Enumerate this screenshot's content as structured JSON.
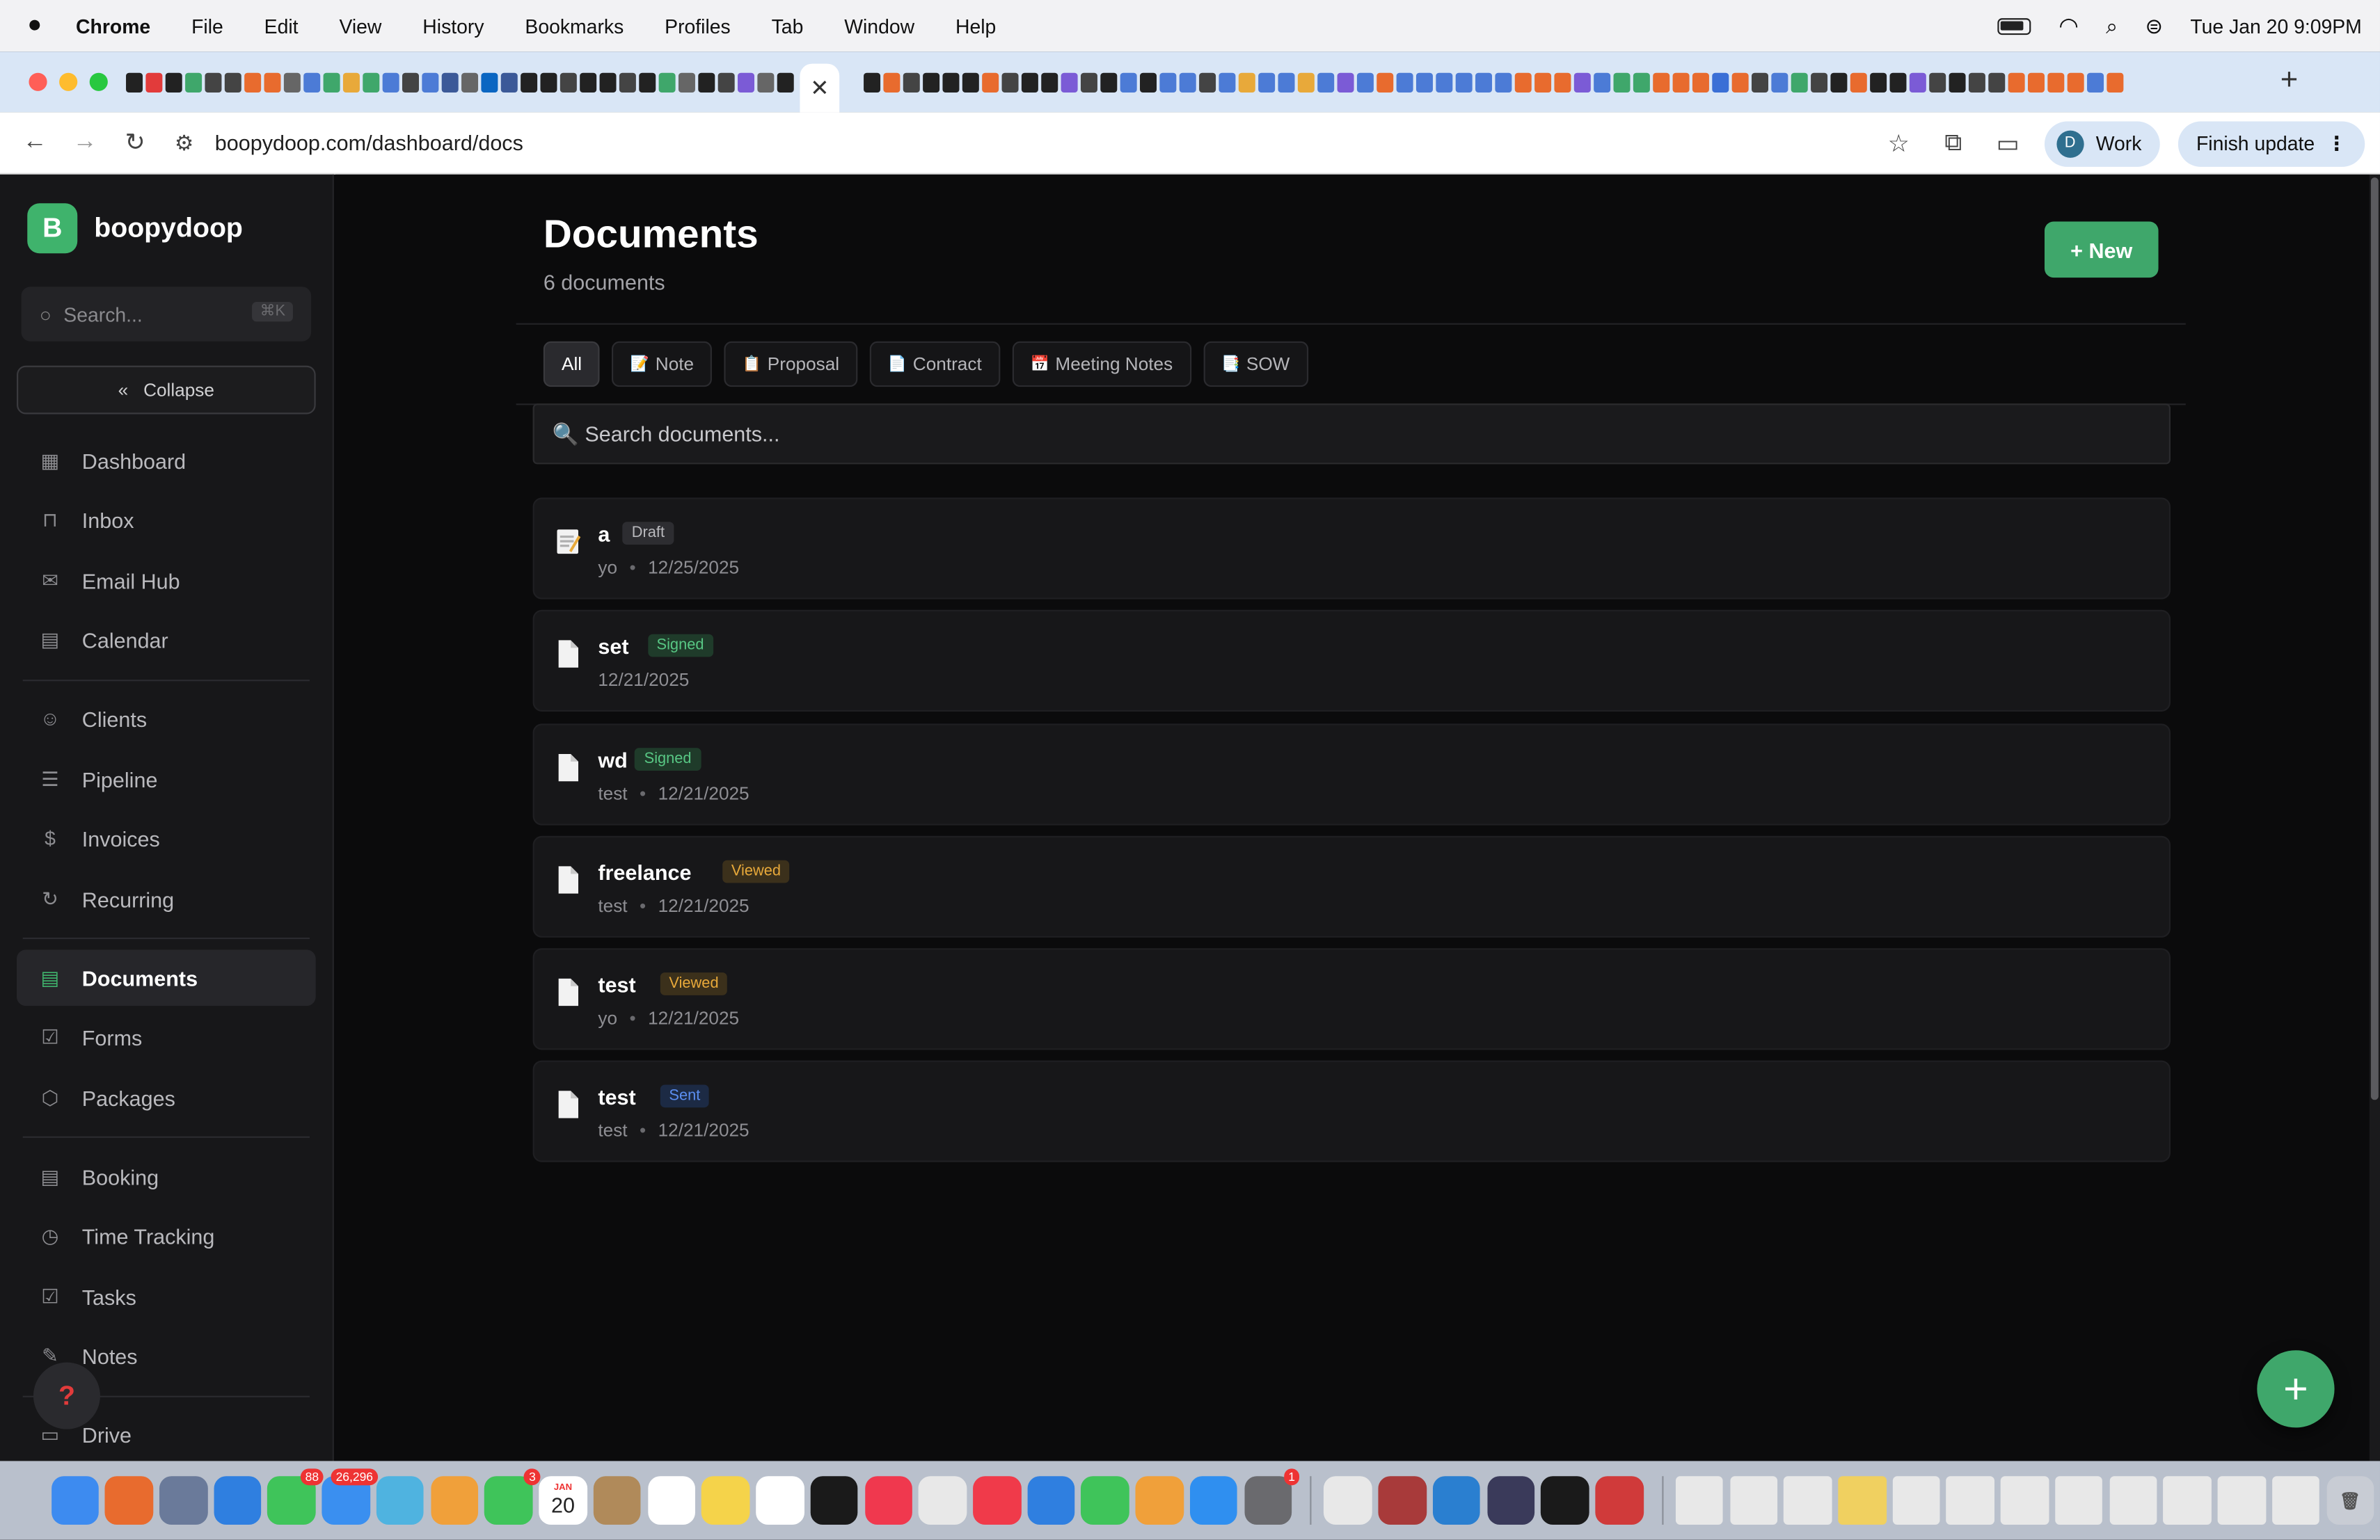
{
  "menubar": {
    "app": "Chrome",
    "items": [
      "File",
      "Edit",
      "View",
      "History",
      "Bookmarks",
      "Profiles",
      "Tab",
      "Window",
      "Help"
    ],
    "clock": "Tue Jan 20  9:09PM"
  },
  "browser": {
    "close_tab_glyph": "✕",
    "new_tab_glyph": "+",
    "url": "boopydoop.com/dashboard/docs",
    "profile_initial": "D",
    "profile_label": "Work",
    "update_label": "Finish update",
    "favicon_colors": [
      "#222",
      "#e23b3b",
      "#222",
      "#3fa76b",
      "#444",
      "#444",
      "#e86b2e",
      "#e86b2e",
      "#666",
      "#4c7bd6",
      "#3fa76b",
      "#e8a93a",
      "#3fa76b",
      "#4c7bd6",
      "#444",
      "#4c7bd6",
      "#3b5998",
      "#666",
      "#0a66c2",
      "#3b5998",
      "#222",
      "#222",
      "#444",
      "#222",
      "#222",
      "#444",
      "#222",
      "#3fa76b",
      "#666",
      "#222",
      "#444",
      "#7b5bd6",
      "#666",
      "#222"
    ],
    "favicon_colors_right": [
      "#222",
      "#e86b2e",
      "#444",
      "#222",
      "#222",
      "#222",
      "#e86b2e",
      "#444",
      "#222",
      "#222",
      "#7b5bd6",
      "#444",
      "#222",
      "#4c7bd6",
      "#222",
      "#4c7bd6",
      "#4c7bd6",
      "#444",
      "#4c7bd6",
      "#e8a93a",
      "#4c7bd6",
      "#4c7bd6",
      "#e8a93a",
      "#4c7bd6",
      "#7b5bd6",
      "#4c7bd6",
      "#e86b2e",
      "#4c7bd6",
      "#4c7bd6",
      "#4c7bd6",
      "#4c7bd6",
      "#4c7bd6",
      "#4c7bd6",
      "#e86b2e",
      "#e86b2e",
      "#e86b2e",
      "#7b5bd6",
      "#4c7bd6",
      "#3fa76b",
      "#3fa76b",
      "#e86b2e",
      "#e86b2e",
      "#e86b2e",
      "#3a6fd6",
      "#e86b2e",
      "#444",
      "#4c7bd6",
      "#3fa76b",
      "#444",
      "#222",
      "#e86b2e",
      "#222",
      "#222",
      "#7b5bd6",
      "#444",
      "#222",
      "#444",
      "#444",
      "#e86b2e",
      "#e86b2e",
      "#e86b2e",
      "#e86b2e",
      "#4c7bd6",
      "#e86b2e"
    ]
  },
  "sidebar": {
    "brand_initial": "B",
    "brand_name": "boopydoop",
    "search_placeholder": "Search...",
    "search_kbd": "⌘K",
    "collapse_label": "Collapse",
    "groups": [
      [
        {
          "label": "Dashboard",
          "icon": "grid-icon",
          "glyph": "▦",
          "active": false
        },
        {
          "label": "Inbox",
          "icon": "inbox-icon",
          "glyph": "⊓",
          "active": false
        },
        {
          "label": "Email Hub",
          "icon": "mail-icon",
          "glyph": "✉",
          "active": false
        },
        {
          "label": "Calendar",
          "icon": "calendar-icon",
          "glyph": "▤",
          "active": false
        }
      ],
      [
        {
          "label": "Clients",
          "icon": "users-icon",
          "glyph": "☺",
          "active": false
        },
        {
          "label": "Pipeline",
          "icon": "list-icon",
          "glyph": "☰",
          "active": false
        },
        {
          "label": "Invoices",
          "icon": "dollar-icon",
          "glyph": "$",
          "active": false
        },
        {
          "label": "Recurring",
          "icon": "refresh-icon",
          "glyph": "↻",
          "active": false
        }
      ],
      [
        {
          "label": "Documents",
          "icon": "document-icon",
          "glyph": "▤",
          "active": true
        },
        {
          "label": "Forms",
          "icon": "checkbox-icon",
          "glyph": "☑",
          "active": false
        },
        {
          "label": "Packages",
          "icon": "package-icon",
          "glyph": "⬡",
          "active": false
        }
      ],
      [
        {
          "label": "Booking",
          "icon": "calendar-icon",
          "glyph": "▤",
          "active": false
        },
        {
          "label": "Time Tracking",
          "icon": "clock-icon",
          "glyph": "◷",
          "active": false
        },
        {
          "label": "Tasks",
          "icon": "checkbox-icon",
          "glyph": "☑",
          "active": false
        },
        {
          "label": "Notes",
          "icon": "pencil-icon",
          "glyph": "✎",
          "active": false
        }
      ],
      [
        {
          "label": "Drive",
          "icon": "folder-icon",
          "glyph": "▭",
          "active": false
        }
      ]
    ]
  },
  "main": {
    "title": "Documents",
    "subtitle": "6 documents",
    "new_label": "+ New",
    "filters": [
      {
        "label": "All",
        "icon": "",
        "active": true
      },
      {
        "label": "Note",
        "icon": "📝",
        "active": false
      },
      {
        "label": "Proposal",
        "icon": "📋",
        "active": false
      },
      {
        "label": "Contract",
        "icon": "📄",
        "active": false
      },
      {
        "label": "Meeting Notes",
        "icon": "📅",
        "active": false
      },
      {
        "label": "SOW",
        "icon": "📑",
        "active": false
      }
    ],
    "search_placeholder": "🔍 Search documents...",
    "docs": [
      {
        "title": "a",
        "status": "Draft",
        "status_type": "draft",
        "client": "yo",
        "date": "12/25/2025",
        "icon": "note"
      },
      {
        "title": "set",
        "status": "Signed",
        "status_type": "signed",
        "client": "",
        "date": "12/21/2025",
        "icon": "page"
      },
      {
        "title": "wd",
        "status": "Signed",
        "status_type": "signed",
        "client": "test",
        "date": "12/21/2025",
        "icon": "page"
      },
      {
        "title": "freelance",
        "status": "Viewed",
        "status_type": "viewed",
        "client": "test",
        "date": "12/21/2025",
        "icon": "page"
      },
      {
        "title": "test",
        "status": "Viewed",
        "status_type": "viewed",
        "client": "yo",
        "date": "12/21/2025",
        "icon": "page"
      },
      {
        "title": "test",
        "status": "Sent",
        "status_type": "sent",
        "client": "test",
        "date": "12/21/2025",
        "icon": "page"
      }
    ],
    "fab_label": "+"
  },
  "dock": {
    "apps": [
      {
        "name": "finder",
        "color": "#3d8bf0",
        "badge": ""
      },
      {
        "name": "launchpad",
        "color": "#e86b2e",
        "badge": ""
      },
      {
        "name": "preview",
        "color": "#6a7a9a",
        "badge": ""
      },
      {
        "name": "safari",
        "color": "#2f7fe0",
        "badge": ""
      },
      {
        "name": "messages",
        "color": "#3fc45a",
        "badge": "88"
      },
      {
        "name": "mail",
        "color": "#3a8ff0",
        "badge": "26,296"
      },
      {
        "name": "maps",
        "color": "#4fb3e0",
        "badge": ""
      },
      {
        "name": "photos",
        "color": "#f0a03a",
        "badge": ""
      },
      {
        "name": "facetime",
        "color": "#3fc45a",
        "badge": "3"
      },
      {
        "name": "calendar",
        "color": "#ffffff",
        "badge": ""
      },
      {
        "name": "contacts",
        "color": "#b08a5a",
        "badge": ""
      },
      {
        "name": "reminders",
        "color": "#ffffff",
        "badge": ""
      },
      {
        "name": "notes",
        "color": "#f5d34a",
        "badge": ""
      },
      {
        "name": "freeform",
        "color": "#ffffff",
        "badge": ""
      },
      {
        "name": "tv",
        "color": "#1a1a1a",
        "badge": ""
      },
      {
        "name": "music",
        "color": "#f0384e",
        "badge": ""
      },
      {
        "name": "chrome",
        "color": "#e8e8e8",
        "badge": ""
      },
      {
        "name": "news",
        "color": "#f03a4a",
        "badge": ""
      },
      {
        "name": "keynote",
        "color": "#2f7fe0",
        "badge": ""
      },
      {
        "name": "numbers",
        "color": "#3fc45a",
        "badge": ""
      },
      {
        "name": "pages",
        "color": "#f0a03a",
        "badge": ""
      },
      {
        "name": "app-store",
        "color": "#2f8ff0",
        "badge": ""
      },
      {
        "name": "system-settings",
        "color": "#6a6a6e",
        "badge": "1"
      },
      {
        "name": "textedit",
        "color": "#e8e8e8",
        "badge": ""
      },
      {
        "name": "dictionary",
        "color": "#a83a3a",
        "badge": ""
      },
      {
        "name": "vscode",
        "color": "#2a7fd0",
        "badge": ""
      },
      {
        "name": "stack",
        "color": "#3a3a5a",
        "badge": ""
      },
      {
        "name": "terminal",
        "color": "#1a1a1a",
        "badge": ""
      },
      {
        "name": "photo-booth",
        "color": "#d03a3a",
        "badge": ""
      }
    ],
    "recents": [
      "#e8e8e8",
      "#e8e8e8",
      "#e8e8e8",
      "#f0d060",
      "#e8e8e8",
      "#e8e8e8",
      "#e8e8e8",
      "#e8e8e8",
      "#e8e8e8",
      "#e8e8e8",
      "#e8e8e8",
      "#e8e8e8"
    ],
    "dock_date_month": "JAN",
    "dock_date_day": "20"
  }
}
